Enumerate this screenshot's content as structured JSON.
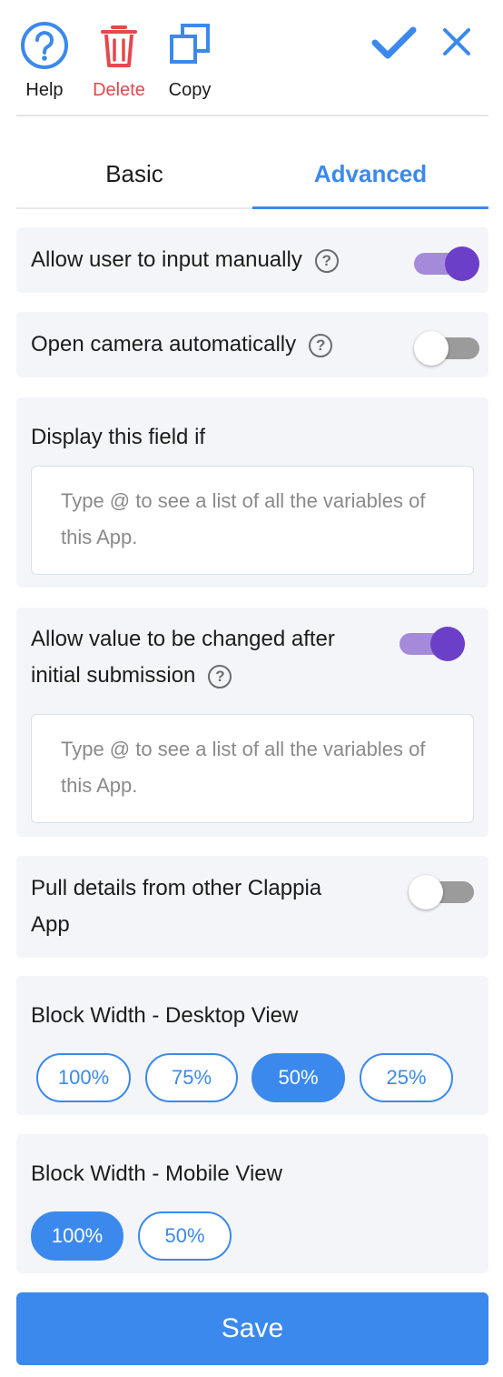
{
  "toolbar": {
    "help_label": "Help",
    "delete_label": "Delete",
    "copy_label": "Copy",
    "accent_color": "#3b89ec",
    "delete_color": "#e5484d"
  },
  "tabs": {
    "basic": "Basic",
    "advanced": "Advanced",
    "active": "Advanced"
  },
  "settings": {
    "allow_manual": {
      "label": "Allow user to input manually",
      "enabled": true
    },
    "open_camera": {
      "label": "Open camera automatically",
      "enabled": false
    },
    "display_if": {
      "label": "Display this field if",
      "placeholder": "Type @ to see a list of all the variables of this App."
    },
    "allow_change": {
      "label_line1": "Allow value to be changed after",
      "label_line2": "initial submission",
      "enabled": true,
      "placeholder": "Type @ to see a list of all the variables of this App."
    },
    "pull_details": {
      "label_line1": "Pull details from other Clappia",
      "label_line2": "App",
      "enabled": false
    }
  },
  "block_width_desktop": {
    "label": "Block Width - Desktop View",
    "options": [
      "100%",
      "75%",
      "50%",
      "25%"
    ],
    "selected": "50%"
  },
  "block_width_mobile": {
    "label": "Block Width - Mobile View",
    "options": [
      "100%",
      "50%"
    ],
    "selected": "100%"
  },
  "save_label": "Save",
  "toggle_on_color": "#6b3fc7"
}
